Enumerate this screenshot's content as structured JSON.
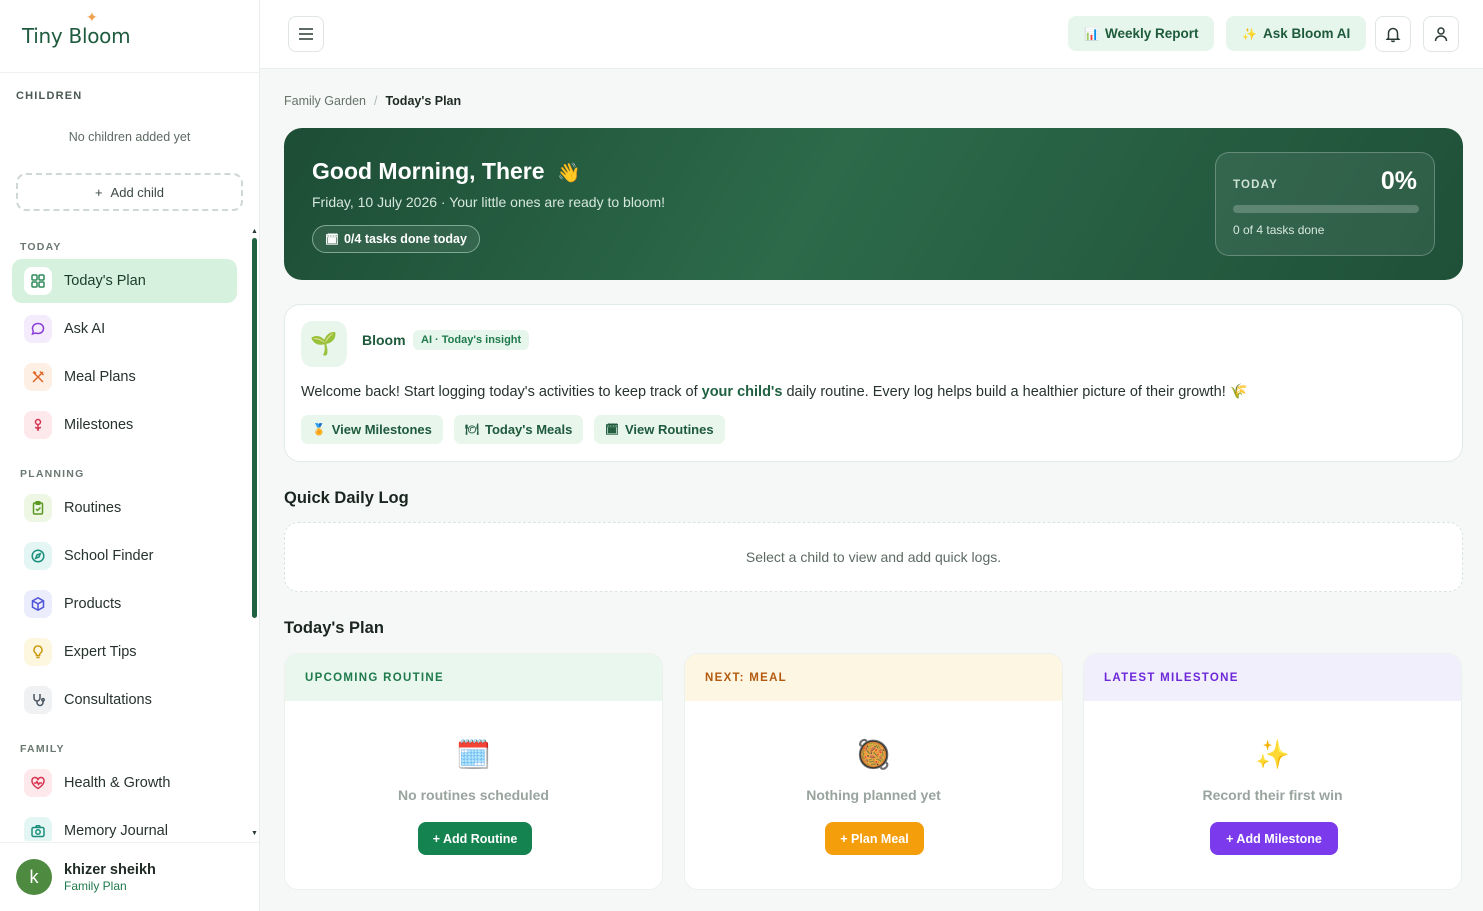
{
  "app": {
    "name": "Tiny Bloom"
  },
  "sidebar": {
    "children_label": "CHILDREN",
    "no_children": "No children added yet",
    "add_child": "Add child",
    "sections": {
      "today": "TODAY",
      "planning": "PLANNING",
      "family": "FAMILY"
    },
    "items": [
      {
        "label": "Today's Plan",
        "icon": "grid-icon",
        "active": true
      },
      {
        "label": "Ask AI",
        "icon": "chat-icon"
      },
      {
        "label": "Meal Plans",
        "icon": "utensils-icon"
      },
      {
        "label": "Milestones",
        "icon": "flower-icon"
      },
      {
        "label": "Routines",
        "icon": "clipboard-icon"
      },
      {
        "label": "School Finder",
        "icon": "compass-icon"
      },
      {
        "label": "Products",
        "icon": "box-icon"
      },
      {
        "label": "Expert Tips",
        "icon": "lightbulb-icon"
      },
      {
        "label": "Consultations",
        "icon": "stethoscope-icon"
      },
      {
        "label": "Health & Growth",
        "icon": "heart-pulse-icon"
      },
      {
        "label": "Memory Journal",
        "icon": "camera-icon"
      }
    ],
    "user": {
      "initial": "k",
      "name": "khizer sheikh",
      "plan": "Family Plan"
    }
  },
  "topbar": {
    "weekly_report": "Weekly Report",
    "ask_bloom": "Ask Bloom AI"
  },
  "breadcrumb": {
    "parent": "Family Garden",
    "separator": "/",
    "current": "Today's Plan"
  },
  "hero": {
    "greeting": "Good Morning, There",
    "wave": "👋",
    "subtitle": "Friday, 10 July 2026 · Your little ones are ready to bloom!",
    "badge": "0/4 tasks done today",
    "today_label": "TODAY",
    "percent": "0%",
    "progress": 0,
    "done_text": "0 of 4 tasks done"
  },
  "insight": {
    "name": "Bloom",
    "tag": "AI · Today's insight",
    "text_before": "Welcome back! Start logging today's activities to keep track of ",
    "text_bold": "your child's",
    "text_after": " daily routine. Every log helps build a healthier picture of their growth! 🌾",
    "chips": [
      "View Milestones",
      "Today's Meals",
      "View Routines"
    ]
  },
  "quick_log": {
    "title": "Quick Daily Log",
    "empty": "Select a child to view and add quick logs."
  },
  "plan": {
    "title": "Today's Plan",
    "cards": [
      {
        "header": "UPCOMING ROUTINE",
        "empty": "No routines scheduled",
        "button": "+ Add Routine",
        "head_bg": "#e9f7ee",
        "head_color": "#1f7a4c",
        "btn_color": "#14834f"
      },
      {
        "header": "NEXT: MEAL",
        "empty": "Nothing planned yet",
        "button": "+ Plan Meal",
        "head_bg": "#fdf6e3",
        "head_color": "#b35a0f",
        "btn_color": "#f59e0b"
      },
      {
        "header": "LATEST MILESTONE",
        "empty": "Record their first win",
        "button": "+ Add Milestone",
        "head_bg": "#f2effc",
        "head_color": "#6d28d9",
        "btn_color": "#7c3aed"
      }
    ]
  }
}
